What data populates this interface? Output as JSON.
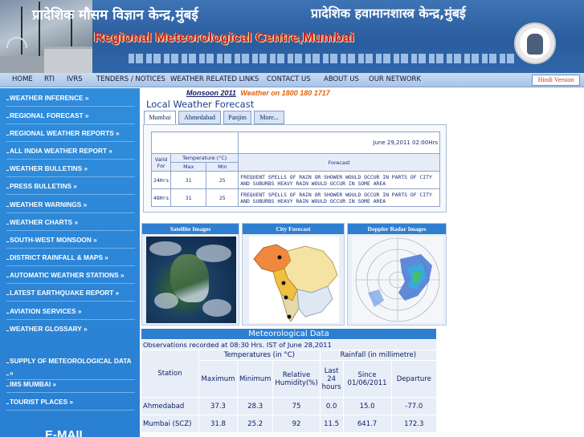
{
  "header": {
    "hindi_left": "प्रादेशिक मौसम विज्ञान केन्द्र,मुंबई",
    "hindi_right": "प्रादेशिक हवामानशास्त्र केन्द्र,मुंबई",
    "title": "Regional Meteorological Centre,Mumbai"
  },
  "topnav": {
    "items": [
      "HOME",
      "RTI",
      "IVRS",
      "TENDERS / NOTICES",
      "WEATHER RELATED LINKS",
      "CONTACT US",
      "ABOUT US",
      "OUR NETWORK"
    ],
    "hindi_version": "Hindi Version"
  },
  "sidebar": {
    "items": [
      "WEATHER INFERENCE »",
      "REGIONAL FORECAST »",
      "REGIONAL WEATHER REPORTS »",
      "ALL INDIA WEATHER REPORT »",
      "WEATHER BULLETINS »",
      "PRESS BULLETINS »",
      "WEATHER WARNINGS »",
      "WEATHER CHARTS »",
      "SOUTH-WEST MONSOON »",
      "DISTRICT RAINFALL & MAPS »",
      "AUTOMATIC WEATHER STATIONS »",
      "LATEST EARTHQUAKE REPORT »",
      "AVIATION SERVICES »",
      "WEATHER GLOSSARY »",
      "SUPPLY OF METEOROLOGICAL DATA",
      "»",
      "IMS MUMBAI »",
      "TOURIST PLACES »"
    ],
    "email": "E-MAIL"
  },
  "monsoon": {
    "label": "Monsoon 2011",
    "phone": "Weather on 1800 180 1717"
  },
  "local_forecast": {
    "title": "Local Weather Forecast",
    "tabs": [
      "Mumbai",
      "Ahmedabad",
      "Panjim",
      "More..."
    ],
    "active_tab": "Mumbai",
    "date": "June 29,2011 02:00Hrs",
    "headers": {
      "valid_for": "Valid For",
      "temperature": "Temperature (°C)",
      "max": "Max",
      "min": "Min",
      "forecast": "Forecast"
    },
    "rows": [
      {
        "valid": "24Hrs",
        "max": "31",
        "min": "25",
        "forecast": "FREQUENT SPELLS OF RAIN OR SHOWER WOULD OCCUR IN PARTS OF CITY AND SUBURBS HEAVY RAIN WOULD OCCUR IN SOME AREA"
      },
      {
        "valid": "48Hrs",
        "max": "31",
        "min": "25",
        "forecast": "FREQUENT SPELLS OF RAIN OR SHOWER WOULD OCCUR IN PARTS OF CITY AND SUBURBS HEAVY RAIN WOULD OCCUR IN SOME AREA"
      }
    ]
  },
  "panels": {
    "satellite": "Satellite Images",
    "city_forecast": "City Forecast",
    "doppler": "Doppler Radar Images"
  },
  "met_data": {
    "title": "Meteorological Data",
    "observation": "Observations recorded at 08:30 Hrs. IST of June 28,2011",
    "station": "Station",
    "temperatures": "Temperatures (in °C)",
    "maximum": "Maximum",
    "minimum": "Minimum",
    "relative_humidity": "Relative Humidity(%)",
    "rainfall": "Rainfall (in millimetre)",
    "last_24": "Last 24 hours",
    "since": "Since 01/06/2011",
    "departure": "Departure",
    "rows": [
      {
        "station": "Ahmedabad",
        "max": "37.3",
        "min": "28.3",
        "rh": "75",
        "last24": "0.0",
        "since": "15.0",
        "departure": "-77.0"
      },
      {
        "station": "Mumbai (SCZ)",
        "max": "31.8",
        "min": "25.2",
        "rh": "92",
        "last24": "11.5",
        "since": "641.7",
        "departure": "172.3"
      }
    ]
  },
  "colors": {
    "sidebar": "#2f8ddc",
    "title_red": "#c62020",
    "accent_orange": "#e0620a",
    "nav_bg": "#c9dcf3"
  }
}
